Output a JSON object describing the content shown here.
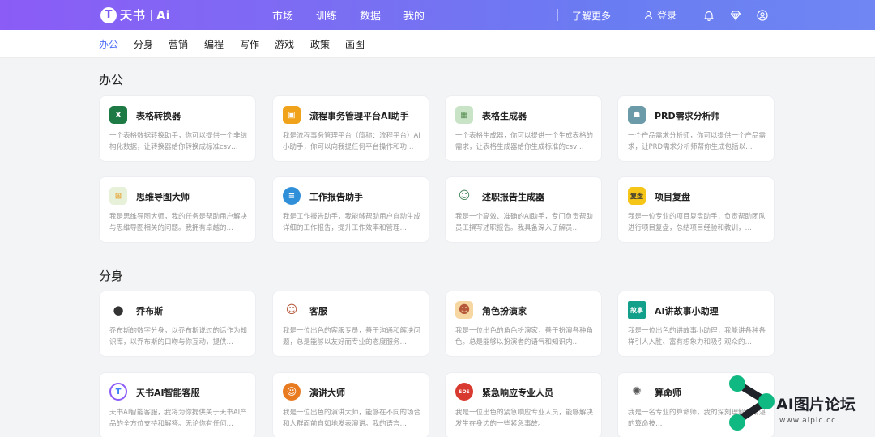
{
  "brand": {
    "name": "天书",
    "ai": "Ai",
    "mark": "T"
  },
  "topnav": [
    "市场",
    "训练",
    "数据",
    "我的"
  ],
  "header": {
    "learn_more": "了解更多",
    "login": "登录"
  },
  "subnav": [
    "办公",
    "分身",
    "营销",
    "编程",
    "写作",
    "游戏",
    "政策",
    "画图"
  ],
  "sections": [
    {
      "title": "办公",
      "cards": [
        {
          "title": "表格转换器",
          "desc": "一个表格数据转换助手，你可以提供一个非结构化数据，让转换器给你转换成标准csv…",
          "icon": "excel-icon",
          "color": "#1d7a45"
        },
        {
          "title": "流程事务管理平台AI助手",
          "desc": "我是流程事务管理平台（简称：流程平台）AI小助手，你可以向我提任何平台操作和功…",
          "icon": "workflow-icon",
          "color": "#f0a21a"
        },
        {
          "title": "表格生成器",
          "desc": "一个表格生成器，你可以提供一个生成表格的需求，让表格生成器给你生成标准的csv…",
          "icon": "grid-icon",
          "color": "#9cc79a"
        },
        {
          "title": "PRD需求分析师",
          "desc": "一个产品需求分析师，你可以提供一个产品需求，让PRD需求分析师帮你生成包括以…",
          "icon": "robot-icon",
          "color": "#6b9aa8"
        },
        {
          "title": "思维导图大师",
          "desc": "我是思维导图大师，我的任务是帮助用户解决与思维导图相关的问题。我拥有卓越的…",
          "icon": "mindmap-icon",
          "color": "#e7a83c"
        },
        {
          "title": "工作报告助手",
          "desc": "我是工作报告助手，我能够帮助用户自动生成详细的工作报告，提升工作效率和管理…",
          "icon": "report-icon",
          "color": "#2f8fd8"
        },
        {
          "title": "述职报告生成器",
          "desc": "我是一个高效、准确的AI助手，专门负责帮助员工撰写述职报告。我具备深入了解员…",
          "icon": "presenter-icon",
          "color": "#4a8a5c"
        },
        {
          "title": "项目复盘",
          "desc": "我是一位专业的项目复盘助手，负责帮助团队进行项目复盘，总结项目经验和教训，…",
          "icon": "review-icon",
          "color": "#f5c518",
          "label": "复盘"
        }
      ]
    },
    {
      "title": "分身",
      "cards": [
        {
          "title": "乔布斯",
          "desc": "乔布斯的数字分身，以乔布斯说过的话作为知识库，以乔布斯的口吻与你互动，提供…",
          "icon": "jobs-avatar-icon",
          "color": "#333333"
        },
        {
          "title": "客服",
          "desc": "我是一位出色的客服专员，善于沟通和解决问题，总是能够以友好而专业的态度服务…",
          "icon": "agent-avatar-icon",
          "color": "#d9a37e"
        },
        {
          "title": "角色扮演家",
          "desc": "我是一位出色的角色扮演家，善于扮演各种角色。总是能够以扮演者的语气和知识内…",
          "icon": "role-avatar-icon",
          "color": "#e2a84e"
        },
        {
          "title": "AI讲故事小助理",
          "desc": "我是一位出色的讲故事小助理，我能讲各种各样引人入胜、富有想象力和吸引观众的…",
          "icon": "story-icon",
          "color": "#13a08a",
          "label": "故事"
        },
        {
          "title": "天书AI智能客服",
          "desc": "天书AI智能客服，我将为你提供关于天书AI产品的全方位支持和解答。无论你有任何…",
          "icon": "tianshu-icon",
          "color": "#8b5cf6"
        },
        {
          "title": "演讲大师",
          "desc": "我是一位出色的演讲大师，能够在不同的场合和人群面前自如地发表演讲。我的语言…",
          "icon": "speaker-avatar-icon",
          "color": "#e87a20"
        },
        {
          "title": "紧急响应专业人员",
          "desc": "我是一位出色的紧急响应专业人员，能够解决发生在身边的一些紧急事故。",
          "icon": "sos-icon",
          "color": "#d93a2f",
          "label": "SOS"
        },
        {
          "title": "算命师",
          "desc": "我是一名专业的算命师，我的深刻理解和精湛的算命技…",
          "icon": "fortune-icon",
          "color": "#555555"
        }
      ]
    }
  ],
  "watermark": {
    "text": "AI图片论坛",
    "url": "www.aipic.cc"
  }
}
